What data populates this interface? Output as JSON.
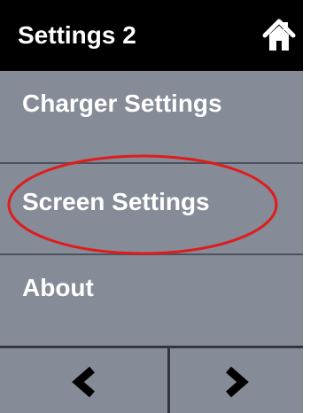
{
  "header": {
    "title": "Settings 2",
    "home_icon": "home-icon"
  },
  "menu": {
    "items": [
      {
        "label": "Charger Settings"
      },
      {
        "label": "Screen Settings"
      },
      {
        "label": "About"
      }
    ]
  },
  "footer": {
    "prev_icon": "chevron-left-icon",
    "next_icon": "chevron-right-icon"
  },
  "annotation": {
    "highlighted_item": "Screen Settings",
    "color": "#e01b1b"
  },
  "colors": {
    "header_bg": "#000000",
    "panel_bg": "#858b97",
    "text": "#ffffff",
    "divider": "#4d535e"
  }
}
